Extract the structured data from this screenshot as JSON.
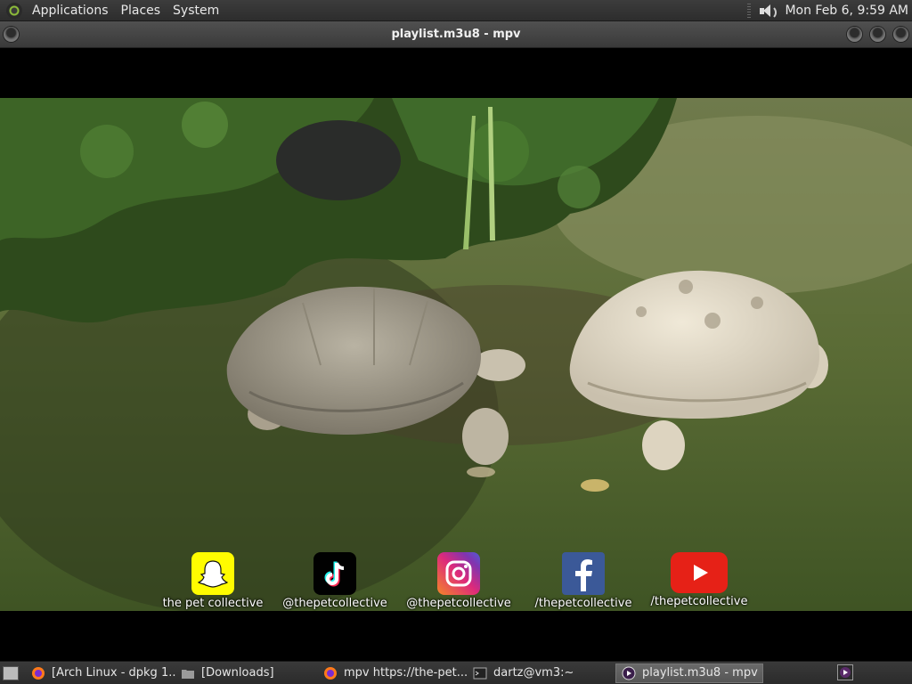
{
  "top_panel": {
    "menus": [
      "Applications",
      "Places",
      "System"
    ],
    "clock": "Mon Feb  6,  9:59 AM"
  },
  "window": {
    "title": "playlist.m3u8 - mpv"
  },
  "video": {
    "socials": [
      {
        "icon": "snapchat-icon",
        "label": "the pet collective",
        "color": "#FFFC00"
      },
      {
        "icon": "tiktok-icon",
        "label": "@thepetcollective",
        "color": "#010101"
      },
      {
        "icon": "instagram-icon",
        "label": "@thepetcollective",
        "color": "#C13584"
      },
      {
        "icon": "facebook-icon",
        "label": "/thepetcollective",
        "color": "#3B5998"
      },
      {
        "icon": "youtube-icon",
        "label": "/thepetcollective",
        "color": "#E62117"
      }
    ]
  },
  "taskbar": {
    "tasks": [
      {
        "icon": "firefox-icon",
        "label": "[Arch Linux - dpkg 1...",
        "active": false
      },
      {
        "icon": "folder-icon",
        "label": "[Downloads]",
        "active": false
      },
      {
        "icon": "firefox-icon",
        "label": "mpv https://the-pet...",
        "active": false
      },
      {
        "icon": "terminal-icon",
        "label": "dartz@vm3:~",
        "active": false
      },
      {
        "icon": "mpv-icon",
        "label": "playlist.m3u8 - mpv",
        "active": true
      }
    ]
  }
}
